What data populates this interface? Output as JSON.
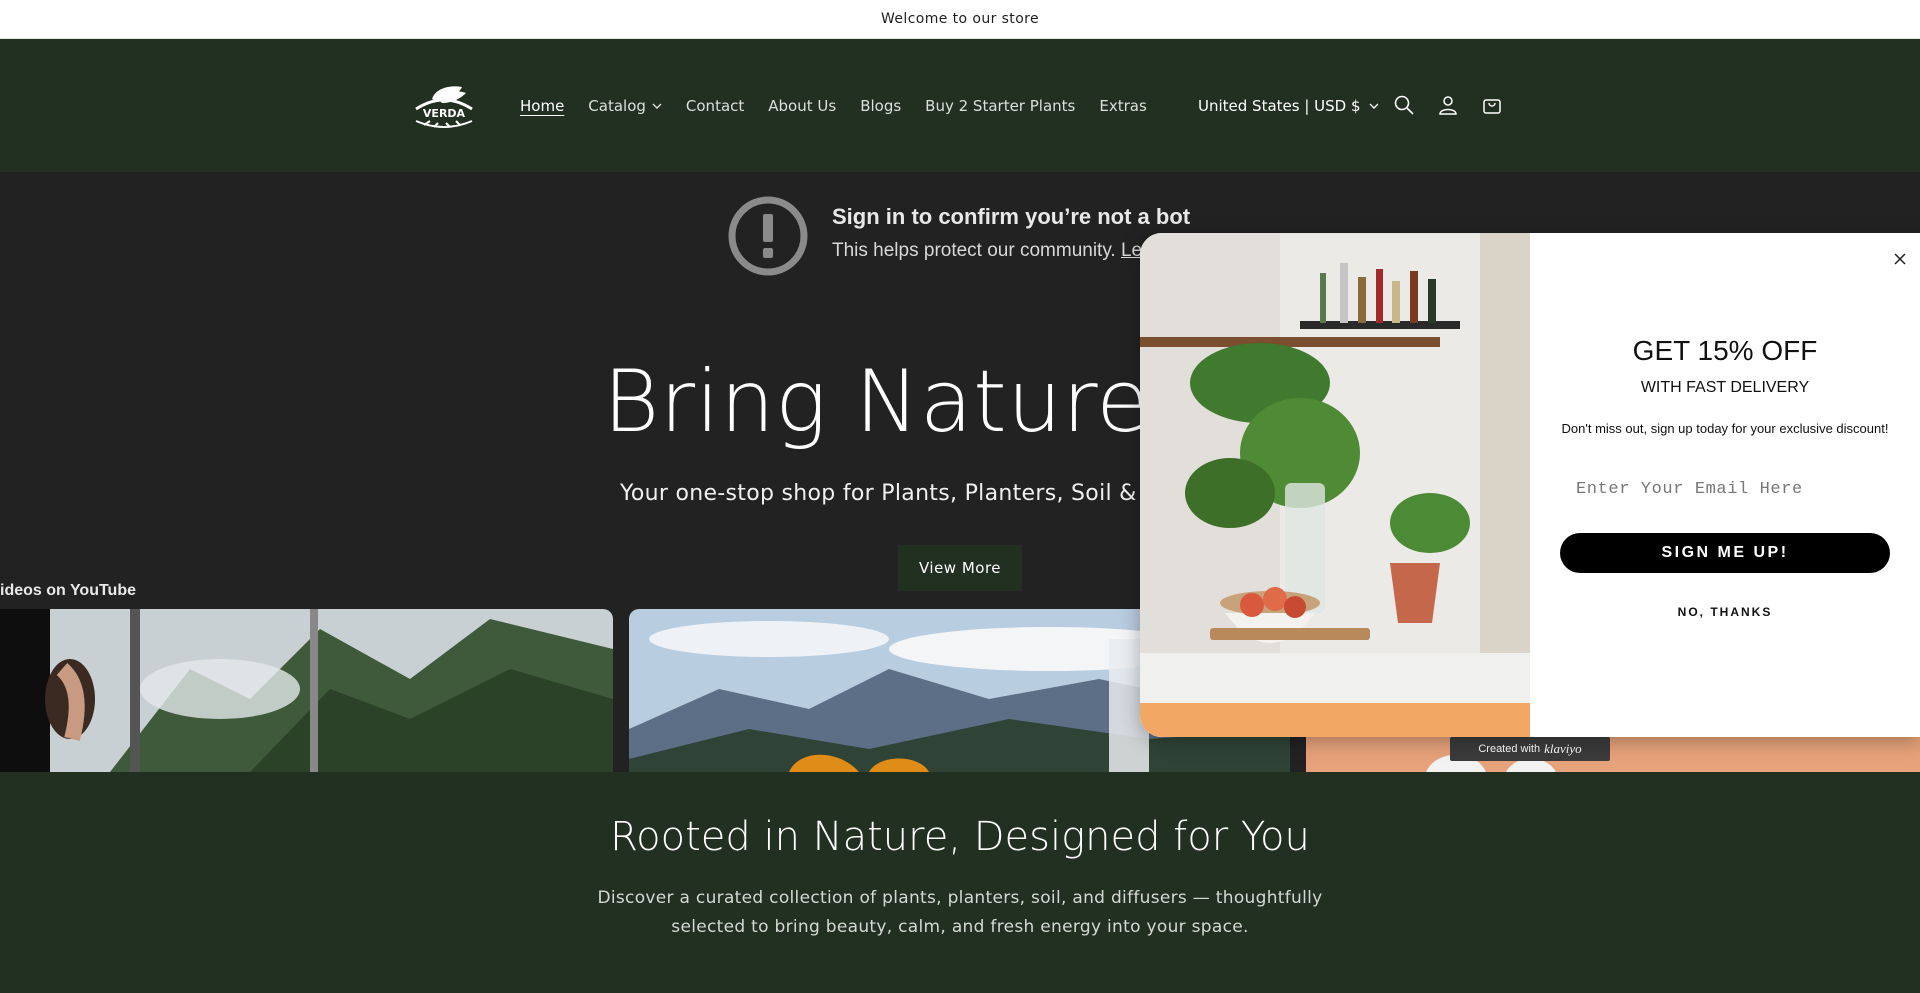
{
  "announcement": {
    "text": "Welcome to our store"
  },
  "header": {
    "logo_text": "VERDA",
    "nav": [
      {
        "label": "Home",
        "active": true
      },
      {
        "label": "Catalog",
        "dropdown": true
      },
      {
        "label": "Contact"
      },
      {
        "label": "About Us"
      },
      {
        "label": "Blogs"
      },
      {
        "label": "Buy 2 Starter Plants"
      },
      {
        "label": "Extras"
      }
    ],
    "country_selector": "United States | USD $",
    "icons": [
      "search-icon",
      "account-icon",
      "cart-icon"
    ]
  },
  "hero": {
    "bot_notice": {
      "title": "Sign in to confirm you’re not a bot",
      "subtitle": "This helps protect our community.",
      "link": "Lear"
    },
    "title": "Bring Nature H",
    "subtitle": "Your one-stop shop for Plants, Planters, Soil & Aro",
    "cta_label": "View More",
    "youtube_label": "ideos on YouTube"
  },
  "popup": {
    "headline": "GET 15% OFF",
    "subheadline": "WITH FAST DELIVERY",
    "body": "Don't miss out, sign up today for your exclusive discount!",
    "email_placeholder": "Enter Your Email Here",
    "submit_label": "SIGN ME UP!",
    "decline_label": "NO, THANKS",
    "badge": {
      "prefix": "Created with",
      "brand": "klaviyo"
    }
  },
  "rooted": {
    "title": "Rooted in Nature, Designed for You",
    "text": "Discover a curated collection of plants, planters, soil, and diffusers — thoughtfully selected to bring beauty, calm, and fresh energy into your space."
  },
  "colors": {
    "header_bg": "#223022",
    "hero_bg": "#222222",
    "button_bg": "#223022",
    "popup_button": "#000000"
  }
}
